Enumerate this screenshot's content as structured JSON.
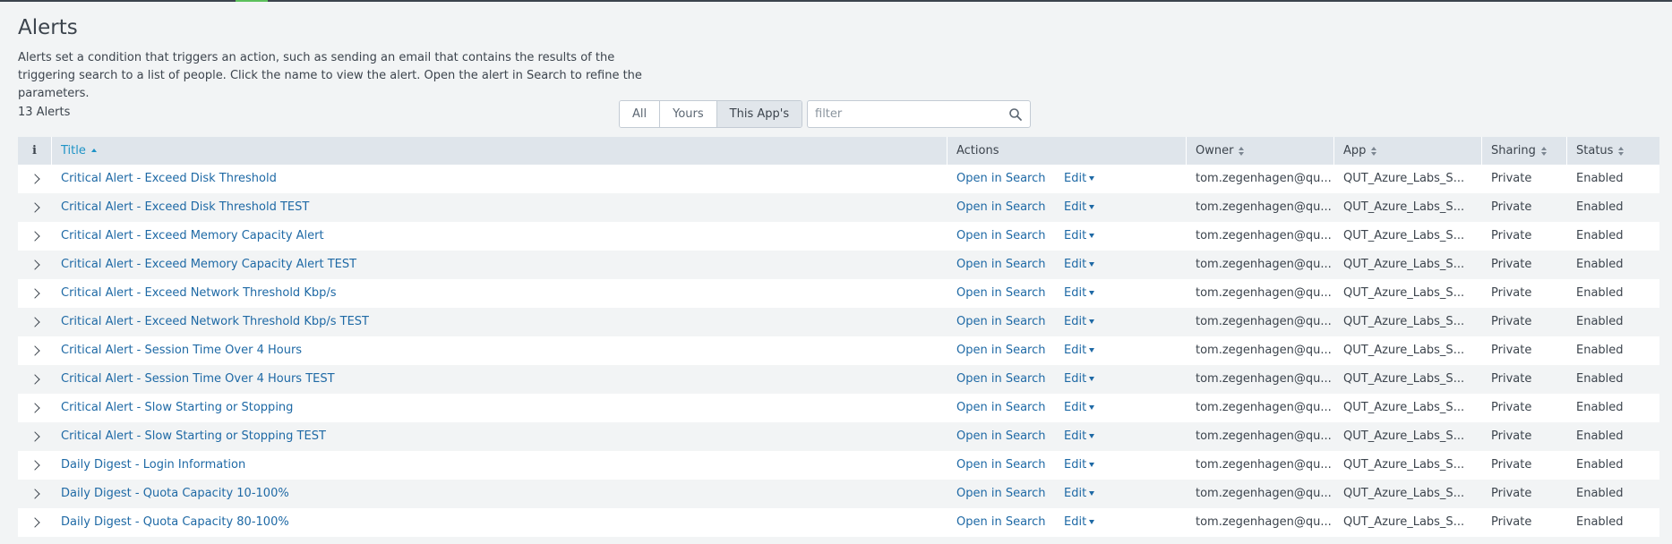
{
  "header": {
    "title": "Alerts",
    "description": "Alerts set a condition that triggers an action, such as sending an email that contains the results of the triggering search to a list of people. Click the name to view the alert. Open the alert in Search to refine the parameters.",
    "count": "13 Alerts"
  },
  "filters": {
    "all": "All",
    "yours": "Yours",
    "this_app": "This App's",
    "selected": "This App's",
    "placeholder": "filter"
  },
  "table": {
    "columns": {
      "info": "i",
      "title": "Title",
      "actions": "Actions",
      "owner": "Owner",
      "app": "App",
      "sharing": "Sharing",
      "status": "Status"
    },
    "open_label": "Open in Search",
    "edit_label": "Edit",
    "rows": [
      {
        "title": "Critical Alert - Exceed Disk Threshold",
        "owner": "tom.zegenhagen@qu...",
        "app": "QUT_Azure_Labs_S...",
        "sharing": "Private",
        "status": "Enabled"
      },
      {
        "title": "Critical Alert - Exceed Disk Threshold TEST",
        "owner": "tom.zegenhagen@qu...",
        "app": "QUT_Azure_Labs_S...",
        "sharing": "Private",
        "status": "Enabled"
      },
      {
        "title": "Critical Alert - Exceed Memory Capacity Alert",
        "owner": "tom.zegenhagen@qu...",
        "app": "QUT_Azure_Labs_S...",
        "sharing": "Private",
        "status": "Enabled"
      },
      {
        "title": "Critical Alert - Exceed Memory Capacity Alert TEST",
        "owner": "tom.zegenhagen@qu...",
        "app": "QUT_Azure_Labs_S...",
        "sharing": "Private",
        "status": "Enabled"
      },
      {
        "title": "Critical Alert - Exceed Network Threshold Kbp/s",
        "owner": "tom.zegenhagen@qu...",
        "app": "QUT_Azure_Labs_S...",
        "sharing": "Private",
        "status": "Enabled"
      },
      {
        "title": "Critical Alert - Exceed Network Threshold Kbp/s TEST",
        "owner": "tom.zegenhagen@qu...",
        "app": "QUT_Azure_Labs_S...",
        "sharing": "Private",
        "status": "Enabled"
      },
      {
        "title": "Critical Alert - Session Time Over 4 Hours",
        "owner": "tom.zegenhagen@qu...",
        "app": "QUT_Azure_Labs_S...",
        "sharing": "Private",
        "status": "Enabled"
      },
      {
        "title": "Critical Alert - Session Time Over 4 Hours TEST",
        "owner": "tom.zegenhagen@qu...",
        "app": "QUT_Azure_Labs_S...",
        "sharing": "Private",
        "status": "Enabled"
      },
      {
        "title": "Critical Alert - Slow Starting or Stopping",
        "owner": "tom.zegenhagen@qu...",
        "app": "QUT_Azure_Labs_S...",
        "sharing": "Private",
        "status": "Enabled"
      },
      {
        "title": "Critical Alert - Slow Starting or Stopping TEST",
        "owner": "tom.zegenhagen@qu...",
        "app": "QUT_Azure_Labs_S...",
        "sharing": "Private",
        "status": "Enabled"
      },
      {
        "title": "Daily Digest - Login Information",
        "owner": "tom.zegenhagen@qu...",
        "app": "QUT_Azure_Labs_S...",
        "sharing": "Private",
        "status": "Enabled"
      },
      {
        "title": "Daily Digest - Quota Capacity 10-100%",
        "owner": "tom.zegenhagen@qu...",
        "app": "QUT_Azure_Labs_S...",
        "sharing": "Private",
        "status": "Enabled"
      },
      {
        "title": "Daily Digest - Quota Capacity 80-100%",
        "owner": "tom.zegenhagen@qu...",
        "app": "QUT_Azure_Labs_S...",
        "sharing": "Private",
        "status": "Enabled"
      }
    ]
  }
}
